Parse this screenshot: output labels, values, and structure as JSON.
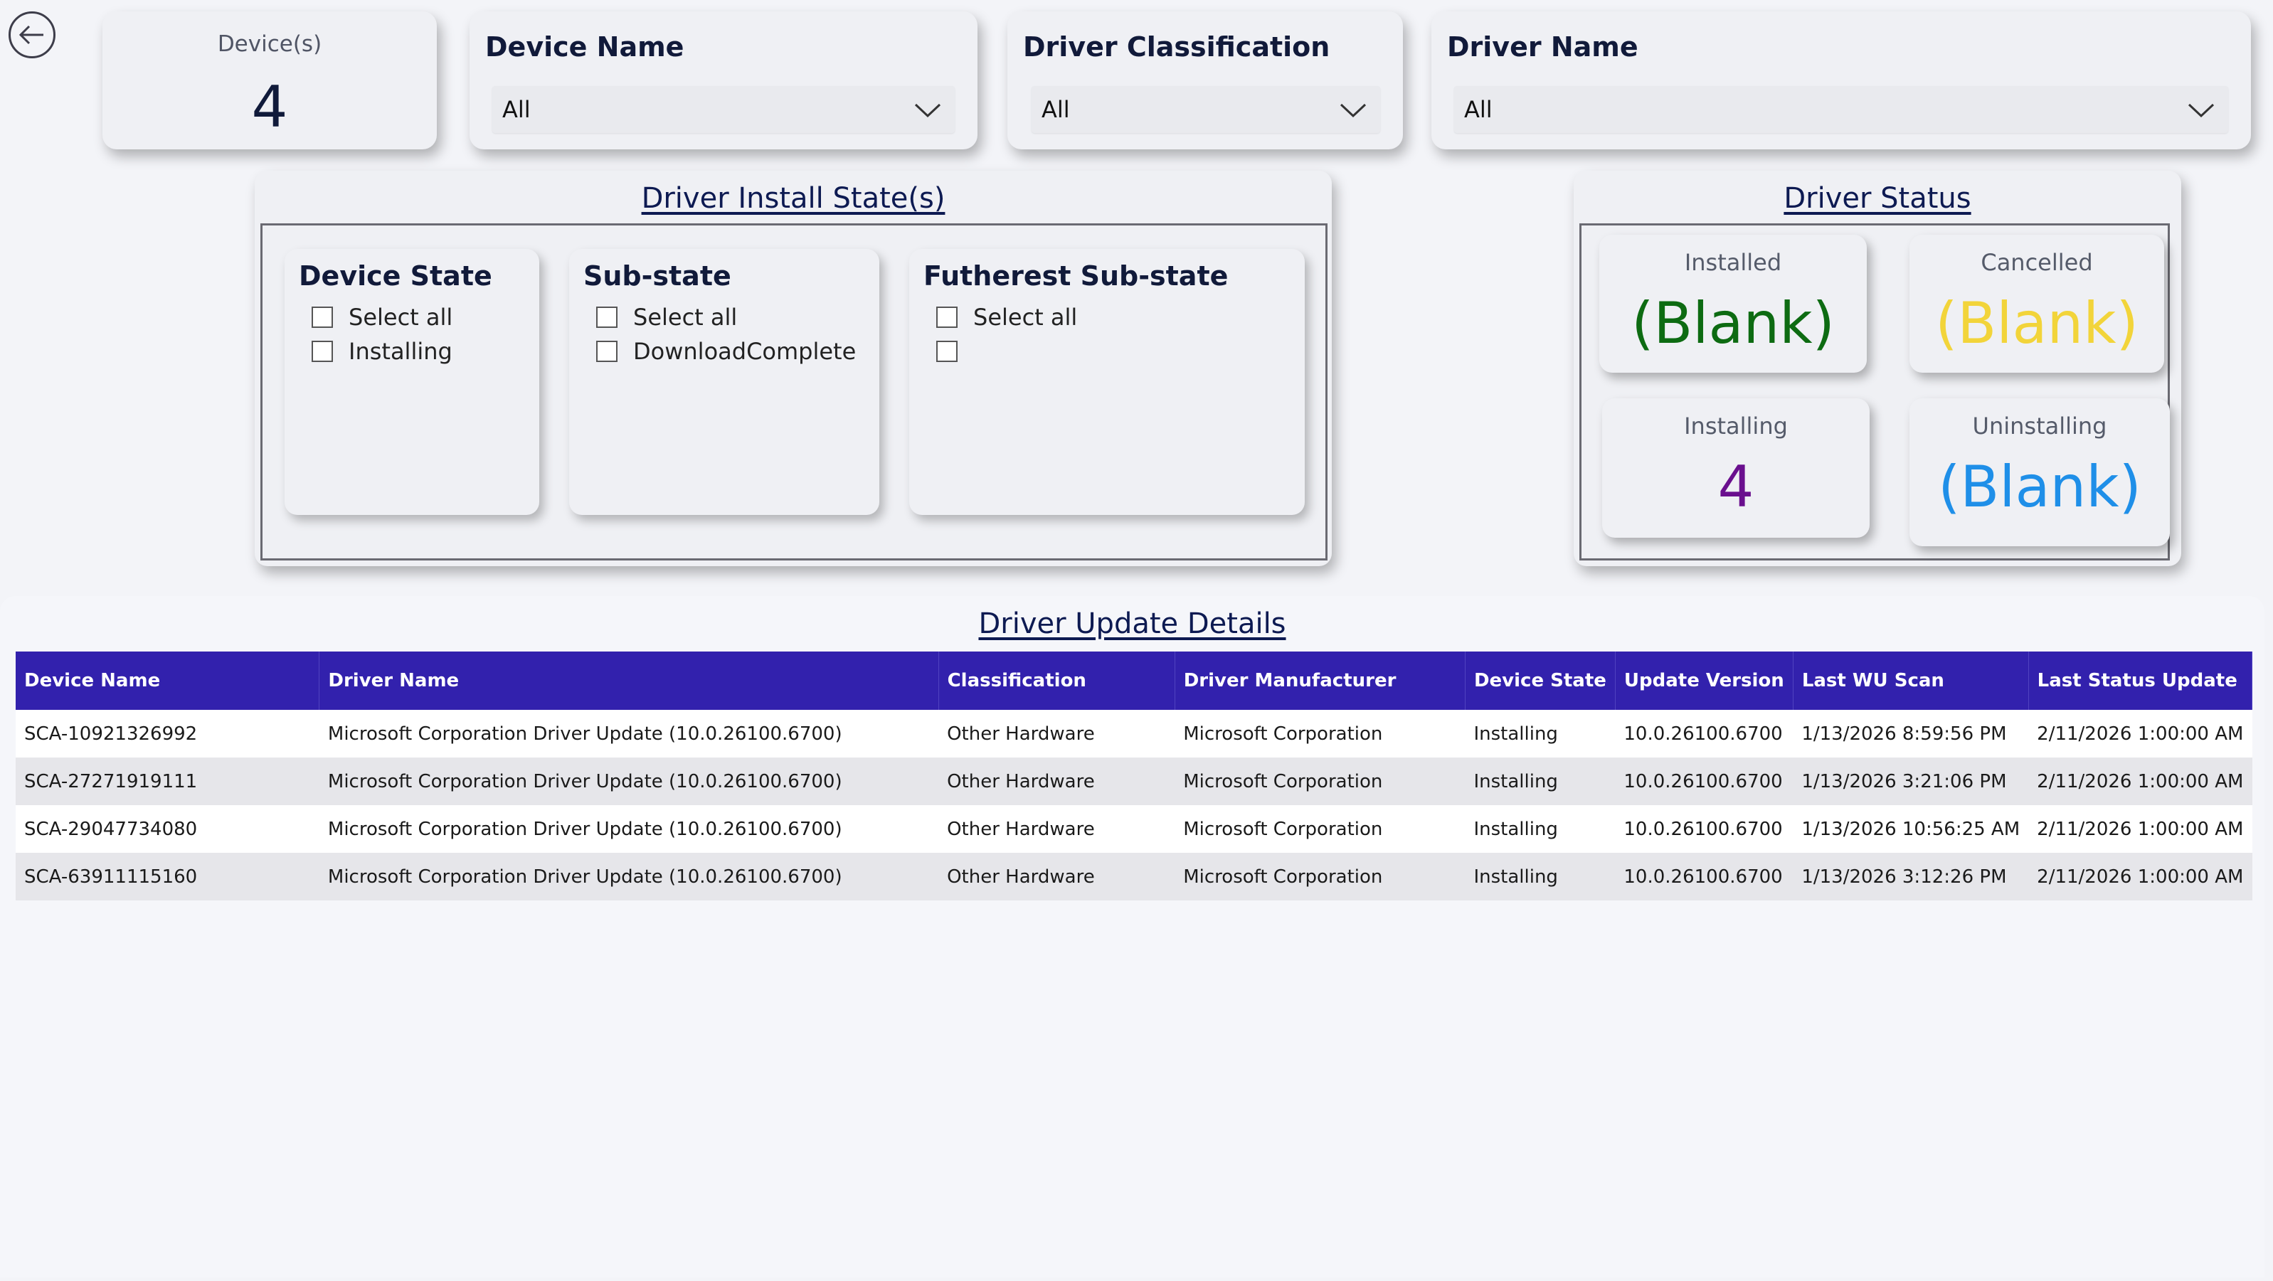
{
  "nav": {
    "back_icon": "back-arrow-icon"
  },
  "kpi": {
    "label": "Device(s)",
    "value": "4"
  },
  "filters": {
    "device_name": {
      "title": "Device Name",
      "value": "All"
    },
    "driver_classification": {
      "title": "Driver Classification",
      "value": "All"
    },
    "driver_name": {
      "title": "Driver Name",
      "value": "All"
    }
  },
  "install_states": {
    "title": "Driver Install State(s)",
    "device_state": {
      "title": "Device State",
      "options": [
        "Select all",
        "Installing"
      ]
    },
    "sub_state": {
      "title": "Sub-state",
      "options": [
        "Select all",
        "DownloadComplete"
      ]
    },
    "furthest_sub_state": {
      "title": "Futherest Sub-state",
      "options": [
        "Select all",
        ""
      ]
    }
  },
  "driver_status": {
    "title": "Driver Status",
    "installed": {
      "label": "Installed",
      "value": "(Blank)",
      "color": "#0d6b12"
    },
    "cancelled": {
      "label": "Cancelled",
      "value": "(Blank)",
      "color": "#f2d43a"
    },
    "installing": {
      "label": "Installing",
      "value": "4",
      "color": "#6a0f8e"
    },
    "uninstalling": {
      "label": "Uninstalling",
      "value": "(Blank)",
      "color": "#1f8fe8"
    }
  },
  "details": {
    "title": "Driver Update Details",
    "header_color": "#3221ad",
    "columns": [
      "Device Name",
      "Driver Name",
      "Classification",
      "Driver Manufacturer",
      "Device State",
      "Update Version",
      "Last WU Scan",
      "Last Status Update"
    ],
    "rows": [
      [
        "SCA-10921326992",
        "Microsoft Corporation Driver Update (10.0.26100.6700)",
        "Other Hardware",
        "Microsoft Corporation",
        "Installing",
        "10.0.26100.6700",
        "1/13/2026 8:59:56 PM",
        "2/11/2026 1:00:00 AM"
      ],
      [
        "SCA-27271919111",
        "Microsoft Corporation Driver Update (10.0.26100.6700)",
        "Other Hardware",
        "Microsoft Corporation",
        "Installing",
        "10.0.26100.6700",
        "1/13/2026 3:21:06 PM",
        "2/11/2026 1:00:00 AM"
      ],
      [
        "SCA-29047734080",
        "Microsoft Corporation Driver Update (10.0.26100.6700)",
        "Other Hardware",
        "Microsoft Corporation",
        "Installing",
        "10.0.26100.6700",
        "1/13/2026 10:56:25 AM",
        "2/11/2026 1:00:00 AM"
      ],
      [
        "SCA-63911115160",
        "Microsoft Corporation Driver Update (10.0.26100.6700)",
        "Other Hardware",
        "Microsoft Corporation",
        "Installing",
        "10.0.26100.6700",
        "1/13/2026 3:12:26 PM",
        "2/11/2026 1:00:00 AM"
      ]
    ]
  }
}
